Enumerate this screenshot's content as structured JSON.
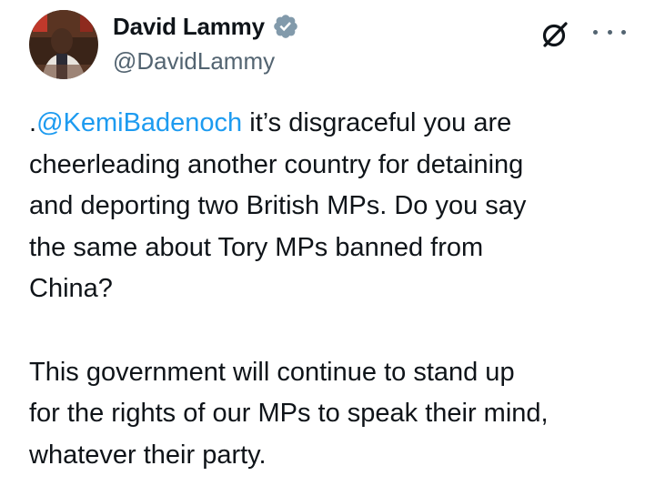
{
  "author": {
    "display_name": "David Lammy",
    "handle": "@DavidLammy",
    "verified": true,
    "verified_color": "#829aab"
  },
  "icons": {
    "avatar": "avatar",
    "verified": "verified-badge-icon",
    "grok": "grok-icon",
    "more": "more-options-icon"
  },
  "tweet": {
    "para1": {
      "prefix": ".",
      "mention": "@KemiBadenoch",
      "line1_rest": " it’s disgraceful you are",
      "line2": "cheerleading another country for detaining",
      "line3": "and deporting two British MPs.  Do you say",
      "line4": "the same about Tory MPs banned from",
      "line5": "China?"
    },
    "para2": {
      "line1": "This government will continue to stand up",
      "line2": "for the rights of our MPs to speak their mind,",
      "line3": "whatever their party."
    }
  },
  "colors": {
    "mention": "#1d9bf0",
    "text": "#0f1419",
    "secondary": "#536471"
  }
}
